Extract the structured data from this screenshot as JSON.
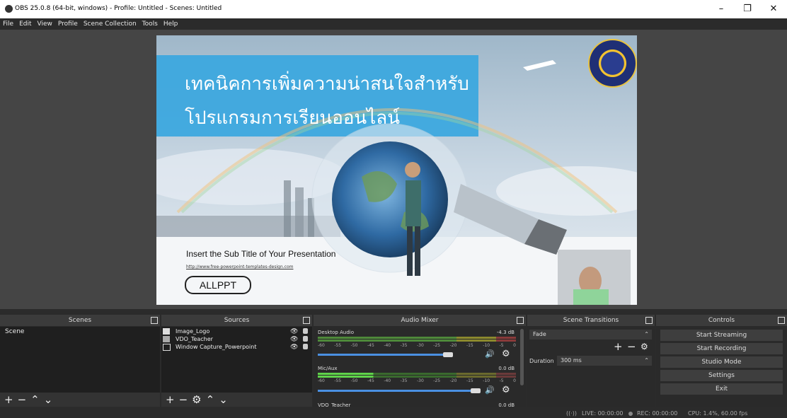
{
  "window": {
    "title": "OBS 25.0.8 (64-bit, windows) - Profile: Untitled - Scenes: Untitled"
  },
  "menu": [
    "File",
    "Edit",
    "View",
    "Profile",
    "Scene Collection",
    "Tools",
    "Help"
  ],
  "slide": {
    "title_line1": "เทคนิคการเพิ่มความน่าสนใจสำหรับ",
    "title_line2": "โปรแกรมการเรียนออนไลน์",
    "subtitle": "Insert the Sub Title of Your Presentation",
    "url": "http://www.free-powerpoint-templates-design.com",
    "logo_text": "ALLPPT"
  },
  "scenes": {
    "title": "Scenes",
    "items": [
      "Scene"
    ]
  },
  "sources": {
    "title": "Sources",
    "items": [
      "Image_Logo",
      "VDO_Teacher",
      "Window Capture_Powerpoint"
    ]
  },
  "mixer": {
    "title": "Audio Mixer",
    "channels": [
      {
        "name": "Desktop Audio",
        "db": "-4.3 dB"
      },
      {
        "name": "Mic/Aux",
        "db": "0.0 dB"
      },
      {
        "name": "VDO_Teacher",
        "db": "0.0 dB"
      }
    ],
    "ticks": [
      "-60",
      "-55",
      "-50",
      "-45",
      "-40",
      "-35",
      "-30",
      "-25",
      "-20",
      "-15",
      "-10",
      "-5",
      "0"
    ]
  },
  "transitions": {
    "title": "Scene Transitions",
    "selected": "Fade",
    "duration_label": "Duration",
    "duration_value": "300 ms"
  },
  "controls": {
    "title": "Controls",
    "buttons": [
      "Start Streaming",
      "Start Recording",
      "Studio Mode",
      "Settings",
      "Exit"
    ]
  },
  "status": {
    "live": "LIVE: 00:00:00",
    "rec": "REC: 00:00:00",
    "cpu": "CPU: 1.4%, 60.00 fps"
  },
  "colors": {
    "accent": "#4a90e2",
    "slide_banner": "#3aa7df"
  }
}
